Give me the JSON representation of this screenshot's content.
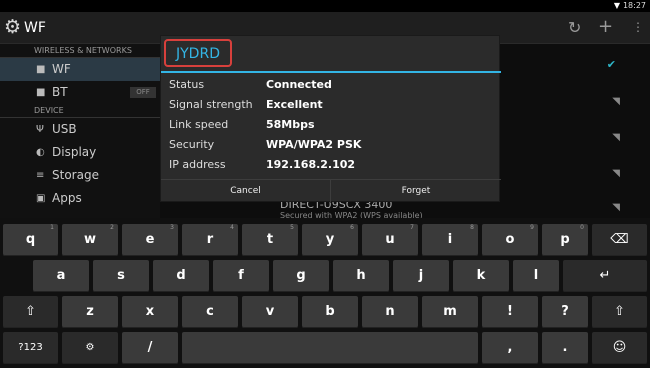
{
  "status_bar": {
    "wifi_icon": "wifi-icon",
    "time": "18:27"
  },
  "action_bar": {
    "title": "WF",
    "icons": [
      "gear-icon",
      "wps-icon",
      "add-icon",
      "overflow-menu-icon"
    ]
  },
  "settings_list": {
    "section_wireless": "WIRELESS & NETWORKS",
    "items_wireless": [
      {
        "icon": "wifi-icon",
        "label": "WF"
      },
      {
        "icon": "bluetooth-icon",
        "label": "BT",
        "toggle": "OFF"
      }
    ],
    "section_device": "DEVICE",
    "items_device": [
      {
        "icon": "usb-icon",
        "label": "USB"
      },
      {
        "icon": "display-icon",
        "label": "Display"
      },
      {
        "icon": "storage-icon",
        "label": "Storage"
      },
      {
        "icon": "apps-icon",
        "label": "Apps"
      }
    ]
  },
  "background_network": {
    "name": "DIRECT-U9SCX 3400",
    "security": "Secured with WPA2 (WPS available)"
  },
  "dialog": {
    "title": "JYDRD",
    "rows": [
      {
        "key": "Status",
        "value": "Connected"
      },
      {
        "key": "Signal strength",
        "value": "Excellent"
      },
      {
        "key": "Link speed",
        "value": "58Mbps"
      },
      {
        "key": "Security",
        "value": "WPA/WPA2 PSK"
      },
      {
        "key": "IP address",
        "value": "192.168.2.102"
      }
    ],
    "cancel_label": "Cancel",
    "forget_label": "Forget"
  },
  "keyboard": {
    "row1": [
      "q",
      "w",
      "e",
      "r",
      "t",
      "y",
      "u",
      "i",
      "o",
      "p"
    ],
    "row1_hints": [
      "1",
      "2",
      "3",
      "4",
      "5",
      "6",
      "7",
      "8",
      "9",
      "0"
    ],
    "row2": [
      "a",
      "s",
      "d",
      "f",
      "g",
      "h",
      "j",
      "k",
      "l"
    ],
    "row3": [
      "z",
      "x",
      "c",
      "v",
      "b",
      "n",
      "m",
      "!",
      "?"
    ],
    "mode_key": "?123",
    "slash_key": "/",
    "comma_key": ",",
    "period_key": ".",
    "shift_symbol": "⇧",
    "backspace_symbol": "⌫",
    "enter_symbol": "↵",
    "settings_symbol": "⚙",
    "smiley_symbol": "☺"
  }
}
